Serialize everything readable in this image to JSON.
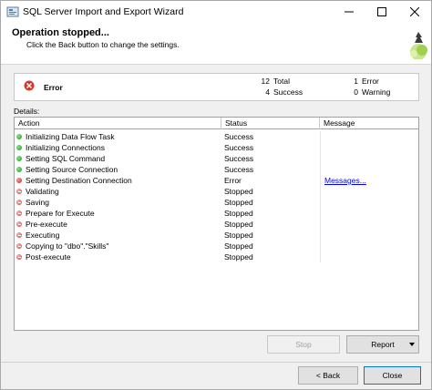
{
  "window": {
    "title": "SQL Server Import and Export Wizard"
  },
  "header": {
    "title": "Operation stopped...",
    "subtitle": "Click the Back button to change the settings."
  },
  "summary": {
    "status": "Error",
    "total_count": "12",
    "total_label": "Total",
    "success_count": "4",
    "success_label": "Success",
    "error_count": "1",
    "error_label": "Error",
    "warning_count": "0",
    "warning_label": "Warning"
  },
  "details": {
    "label": "Details:",
    "columns": [
      "Action",
      "Status",
      "Message"
    ],
    "rows": [
      {
        "action": "Initializing Data Flow Task",
        "status": "Success",
        "message": "",
        "icon": "success-icon"
      },
      {
        "action": "Initializing Connections",
        "status": "Success",
        "message": "",
        "icon": "success-icon"
      },
      {
        "action": "Setting SQL Command",
        "status": "Success",
        "message": "",
        "icon": "success-icon"
      },
      {
        "action": "Setting Source Connection",
        "status": "Success",
        "message": "",
        "icon": "success-icon"
      },
      {
        "action": "Setting Destination Connection",
        "status": "Error",
        "message": "Messages...",
        "icon": "error-icon"
      },
      {
        "action": "Validating",
        "status": "Stopped",
        "message": "",
        "icon": "stopped-icon"
      },
      {
        "action": "Saving",
        "status": "Stopped",
        "message": "",
        "icon": "stopped-icon"
      },
      {
        "action": "Prepare for Execute",
        "status": "Stopped",
        "message": "",
        "icon": "stopped-icon"
      },
      {
        "action": "Pre-execute",
        "status": "Stopped",
        "message": "",
        "icon": "stopped-icon"
      },
      {
        "action": "Executing",
        "status": "Stopped",
        "message": "",
        "icon": "stopped-icon"
      },
      {
        "action": "Copying to \"dbo\".\"Skills\"",
        "status": "Stopped",
        "message": "",
        "icon": "stopped-icon"
      },
      {
        "action": "Post-execute",
        "status": "Stopped",
        "message": "",
        "icon": "stopped-icon"
      }
    ]
  },
  "buttons": {
    "stop": "Stop",
    "report": "Report",
    "back": "< Back",
    "close": "Close"
  },
  "colors": {
    "success": "#1e9b1e",
    "error": "#c81e1e",
    "link": "#0000ee",
    "focus_border": "#0078d7"
  }
}
